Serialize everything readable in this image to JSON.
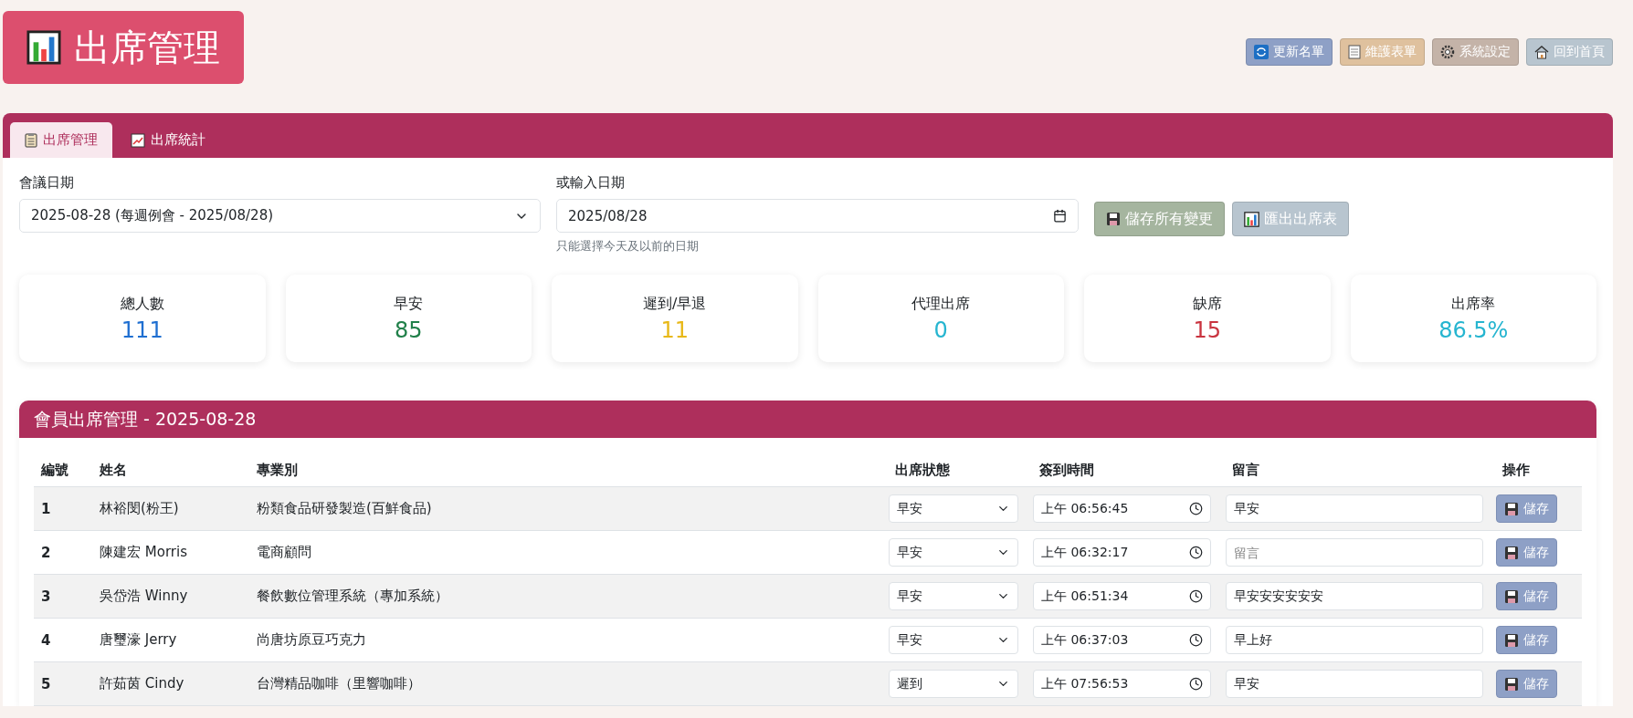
{
  "header": {
    "title": "出席管理"
  },
  "top_actions": [
    {
      "label": "更新名單",
      "kind": "refresh"
    },
    {
      "label": "維護表單",
      "kind": "document"
    },
    {
      "label": "系統設定",
      "kind": "settings"
    },
    {
      "label": "回到首頁",
      "kind": "home"
    }
  ],
  "tabs": [
    {
      "label": "出席管理",
      "kind": "clipboard",
      "selected": true
    },
    {
      "label": "出席統計",
      "kind": "chart",
      "selected": false
    }
  ],
  "filters": {
    "meeting_label": "會議日期",
    "meeting_value": "2025-08-28 (每週例會 - 2025/08/28)",
    "date_label": "或輸入日期",
    "date_value": "2025/08/28",
    "date_hint": "只能選擇今天及以前的日期"
  },
  "form_actions": [
    {
      "label": "儲存所有變更",
      "kind": "save"
    },
    {
      "label": "匯出出席表",
      "kind": "export"
    }
  ],
  "stats": [
    {
      "label": "總人數",
      "value": "111",
      "color": "#1f6fd1"
    },
    {
      "label": "早安",
      "value": "85",
      "color": "#21804a"
    },
    {
      "label": "遲到/早退",
      "value": "11",
      "color": "#e8b817"
    },
    {
      "label": "代理出席",
      "value": "0",
      "color": "#26b5d0"
    },
    {
      "label": "缺席",
      "value": "15",
      "color": "#c9343f"
    },
    {
      "label": "出席率",
      "value": "86.5%",
      "color": "#26b5d0"
    }
  ],
  "table": {
    "title": "會員出席管理 - 2025-08-28",
    "columns": [
      "編號",
      "姓名",
      "專業別",
      "出席狀態",
      "簽到時間",
      "留言",
      "操作"
    ],
    "rows": [
      {
        "number": "1",
        "name": "林裕閔(粉王)",
        "profession": "粉類食品研發製造(百鮮食品)",
        "status": "早安",
        "time": "上午 06:56:45",
        "comment": "早安",
        "action": "儲存"
      },
      {
        "number": "2",
        "name": "陳建宏 Morris",
        "profession": "電商顧問",
        "status": "早安",
        "time": "上午 06:32:17",
        "placeholder": "留言",
        "action": "儲存"
      },
      {
        "number": "3",
        "name": "吳岱浩 Winny",
        "profession": "餐飲數位管理系統（專加系統）",
        "status": "早安",
        "time": "上午 06:51:34",
        "comment": "早安安安安安安",
        "action": "儲存"
      },
      {
        "number": "4",
        "name": "唐璽濠 Jerry",
        "profession": "尚唐坊原豆巧克力",
        "status": "早安",
        "time": "上午 06:37:03",
        "comment": "早上好",
        "action": "儲存"
      },
      {
        "number": "5",
        "name": "許茹茵 Cindy",
        "profession": "台灣精品咖啡（里響咖啡）",
        "status": "遲到",
        "time": "上午 07:56:53",
        "comment": "早安",
        "action": "儲存"
      }
    ]
  }
}
